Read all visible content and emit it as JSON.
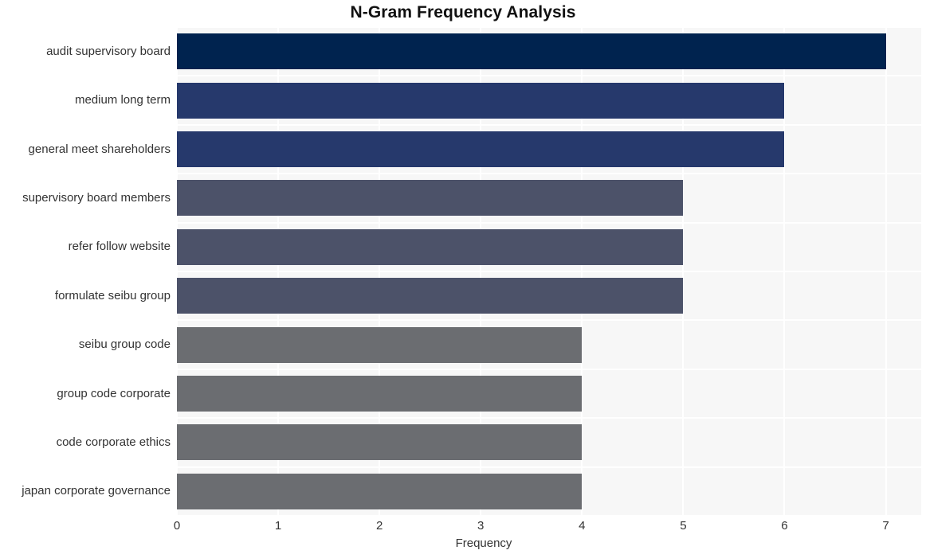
{
  "chart_data": {
    "type": "bar",
    "orientation": "horizontal",
    "title": "N-Gram Frequency Analysis",
    "xlabel": "Frequency",
    "ylabel": "",
    "xlim": [
      0,
      7.35
    ],
    "xticks": [
      "0",
      "1",
      "2",
      "3",
      "4",
      "5",
      "6",
      "7"
    ],
    "xtick_values": [
      0,
      1,
      2,
      3,
      4,
      5,
      6,
      7
    ],
    "grid": true,
    "legend": false,
    "categories": [
      "audit supervisory board",
      "medium long term",
      "general meet shareholders",
      "supervisory board members",
      "refer follow website",
      "formulate seibu group",
      "seibu group code",
      "group code corporate",
      "code corporate ethics",
      "japan corporate governance"
    ],
    "values": [
      7,
      6,
      6,
      5,
      5,
      5,
      4,
      4,
      4,
      4
    ],
    "bar_colors": [
      "#00234f",
      "#26396c",
      "#26396c",
      "#4c5269",
      "#4c5269",
      "#4c5269",
      "#6b6d71",
      "#6b6d71",
      "#6b6d71",
      "#6b6d71"
    ]
  },
  "style": {
    "plot_background": "#f7f7f7",
    "figure_background": "#ffffff",
    "gridline_color": "#ffffff",
    "text_color": "#333333",
    "title_color": "#111111"
  }
}
